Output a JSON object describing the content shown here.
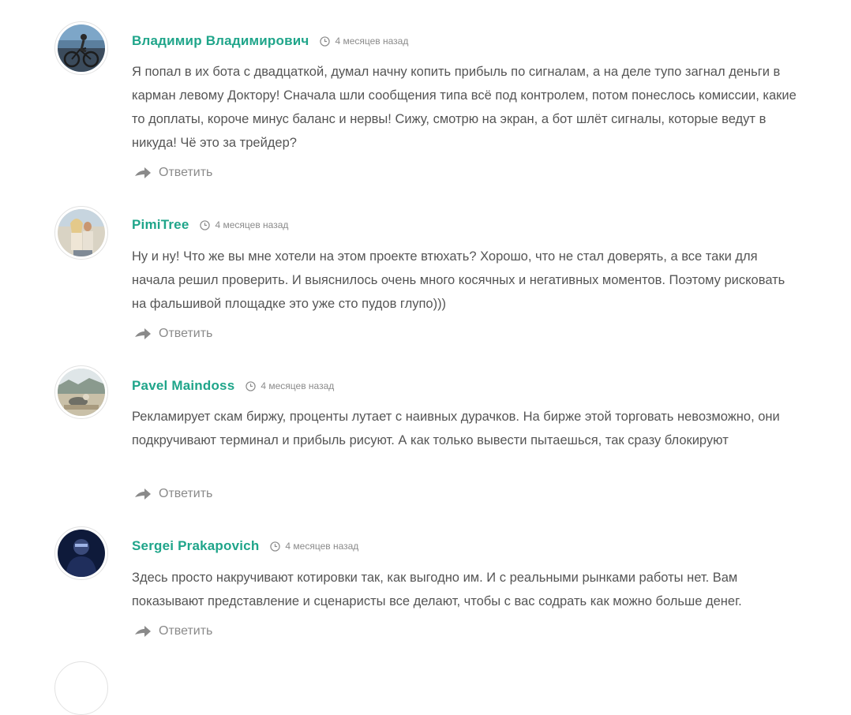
{
  "comments": [
    {
      "author": "Владимир Владимирович",
      "date": "4 месяцев назад",
      "text": "Я попал в их бота с двадцаткой, думал начну копить прибыль по сигналам, а на деле тупо загнал деньги в карман левому Доктору! Сначала шли сообщения типа всё под контролем, потом понеслось комиссии, какие то доплаты, короче минус баланс и нервы! Сижу, смотрю на экран, а бот шлёт сигналы, которые ведут в никуда! Чё это за трейдер?",
      "reply_label": "Ответить"
    },
    {
      "author": "PimiTree",
      "date": "4 месяцев назад",
      "text": "Ну и ну! Что же вы мне хотели на этом проекте втюхать? Хорошо, что не стал доверять, а все таки для начала решил проверить. И выяснилось очень много косячных и негативных моментов. Поэтому рисковать на фальшивой площадке это уже сто пудов глупо)))",
      "reply_label": "Ответить"
    },
    {
      "author": "Pavel Maindoss",
      "date": "4 месяцев назад",
      "text": "Рекламирует скам биржу, проценты лутает с наивных дурачков. На бирже этой торговать невозможно, они подкручивают терминал и прибыль рисуют. А как только вывести пытаешься, так сразу блокируют",
      "reply_label": "Ответить"
    },
    {
      "author": "Sergei Prakapovich",
      "date": "4 месяцев назад",
      "text": "Здесь просто накручивают котировки так, как выгодно им. И с реальными рынками работы нет. Вам показывают представление и сценаристы все делают, чтобы с вас содрать как можно больше денег.",
      "reply_label": "Ответить"
    }
  ],
  "colors": {
    "author": "#1fa58a",
    "text": "#555555",
    "meta": "#8b8b8b"
  },
  "icons": {
    "clock": "clock-icon",
    "reply": "reply-arrow-icon"
  }
}
